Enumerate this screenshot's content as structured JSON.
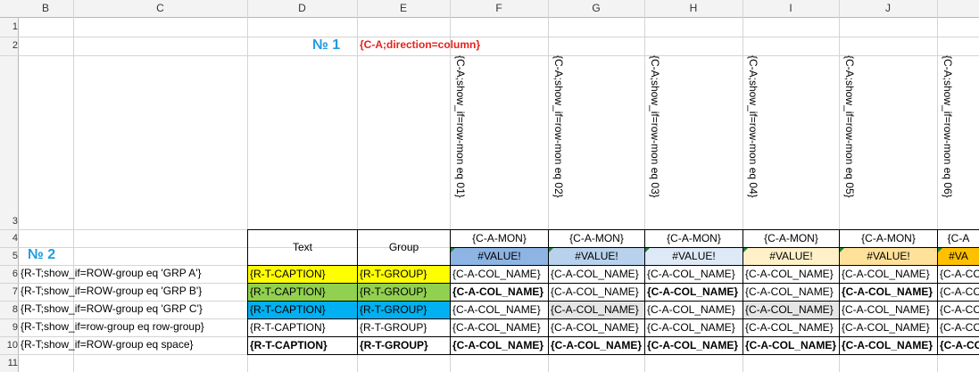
{
  "columns": [
    "B",
    "C",
    "D",
    "E",
    "F",
    "G",
    "H",
    "I",
    "J"
  ],
  "rows": [
    "1",
    "2",
    "3",
    "4",
    "5",
    "6",
    "7",
    "8",
    "9",
    "10",
    "11"
  ],
  "titles": {
    "n1": "№ 1",
    "n2": "№ 2",
    "direction": "{C-A;direction=column}"
  },
  "vertical_labels": [
    "{C-A;show_if=row-mon eq 01}",
    "{C-A;show_if=row-mon eq 02}",
    "{C-A;show_if=row-mon eq 03}",
    "{C-A;show_if=row-mon eq 04}",
    "{C-A;show_if=row-mon eq 05}",
    "{C-A;show_if=row-mon eq 06}"
  ],
  "header": {
    "text": "Text",
    "group": "Group",
    "mon": [
      "{C-A-MON}",
      "{C-A-MON}",
      "{C-A-MON}",
      "{C-A-MON}",
      "{C-A-MON}",
      "{C-A"
    ],
    "value": [
      "#VALUE!",
      "#VALUE!",
      "#VALUE!",
      "#VALUE!",
      "#VALUE!",
      "#VA"
    ]
  },
  "row_labels": [
    "{R-T;show_if=ROW-group eq 'GRP A'}",
    "{R-T;show_if=ROW-group eq 'GRP B'}",
    "{R-T;show_if=ROW-group eq 'GRP C'}",
    "{R-T;show_if=row-group eq row-group}",
    "{R-T;show_if=ROW-group eq space}"
  ],
  "caption": "{R-T-CAPTION}",
  "group": "{R-T-GROUP}",
  "col_name": "{C-A-COL_NAME}",
  "col_name_cut": "{C-A-CC",
  "colors": {
    "yellow": "#ffff00",
    "green": "#92d050",
    "blue": "#00b0f0",
    "mon_fills": [
      "#8db4e2",
      "#b8d1ec",
      "#dde9f6",
      "#fff0c8",
      "#ffe199",
      "#ffc000"
    ],
    "grey_cell": "#e6e6e6",
    "accent_title": "#1f9bde",
    "accent_red": "#e8201c"
  }
}
